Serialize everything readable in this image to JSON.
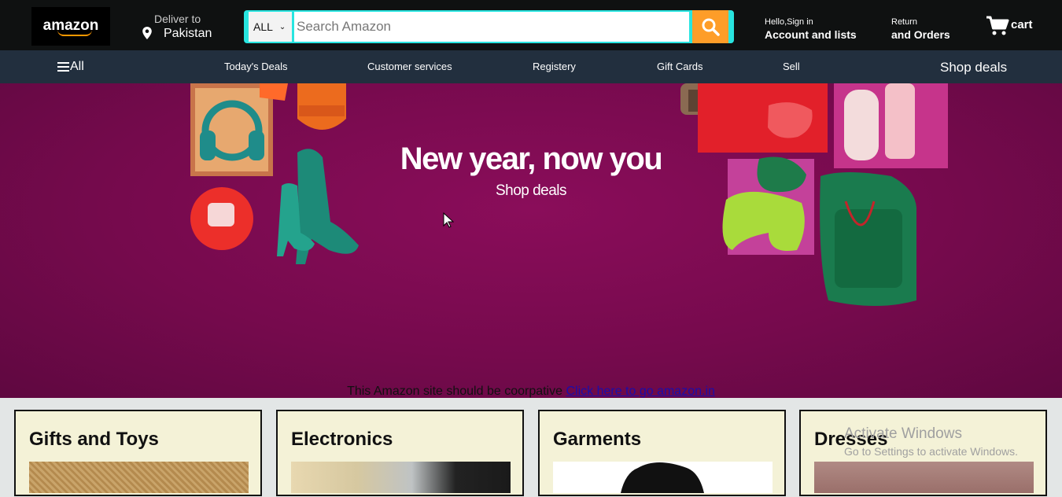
{
  "header": {
    "logo_text": "amazon",
    "deliver_label": "Deliver to",
    "deliver_location": "Pakistan",
    "search_category": "ALL",
    "search_placeholder": "Search Amazon",
    "account_small": "Hello,Sign in",
    "account_big": "Account and lists",
    "returns_small": "Return",
    "returns_big": "and Orders",
    "cart_label": "cart"
  },
  "nav": {
    "all_label": "All",
    "items": [
      "Today's Deals",
      "Customer services",
      "Registery",
      "Gift Cards",
      "Sell"
    ],
    "shop_deals": "Shop deals"
  },
  "hero": {
    "title": "New year, now you",
    "subtitle": "Shop deals",
    "notice_text": "This Amazon site should be coorpative",
    "notice_link": "Click here to go amazon.in"
  },
  "cards": [
    {
      "title": "Gifts and Toys"
    },
    {
      "title": "Electronics"
    },
    {
      "title": "Garments"
    },
    {
      "title": "Dresses"
    }
  ],
  "watermark": {
    "line1": "Activate Windows",
    "line2": "Go to Settings to activate Windows."
  },
  "colors": {
    "header_bg": "#0f1111",
    "nav_bg": "#222f3e",
    "hero_bg": "#760a4d",
    "search_button": "#fe9d28",
    "search_border": "#28e5e0",
    "card_bg": "#f4f2d7"
  }
}
